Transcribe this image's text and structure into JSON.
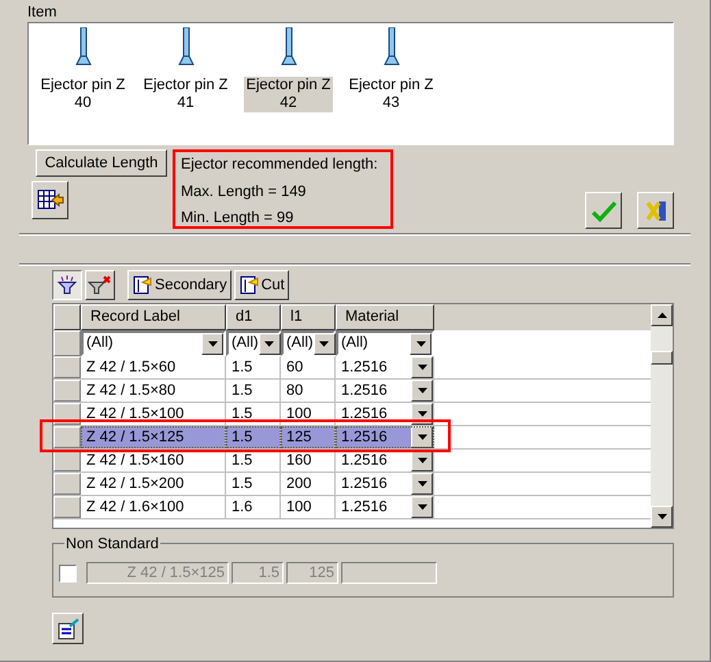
{
  "item_group": {
    "label": "Item"
  },
  "items": [
    {
      "name": "Ejector pin Z",
      "size": "40",
      "selected": false
    },
    {
      "name": "Ejector pin Z",
      "size": "41",
      "selected": false
    },
    {
      "name": "Ejector pin Z",
      "size": "42",
      "selected": true
    },
    {
      "name": "Ejector pin Z",
      "size": "43",
      "selected": false
    }
  ],
  "calculate_button": "Calculate Length",
  "recommendation": {
    "title": "Ejector recommended length:",
    "max": "Max. Length = 149",
    "min": "Min. Length = 99"
  },
  "toolbar": {
    "filter_on": true,
    "secondary": "Secondary",
    "cut": "Cut"
  },
  "table": {
    "columns": [
      "Record Label",
      "d1",
      "l1",
      "Material"
    ],
    "filters": [
      "(All)",
      "(All)",
      "(All)",
      "(All)"
    ],
    "rows": [
      {
        "label": "Z 42 / 1.5×60",
        "d1": "1.5",
        "l1": "60",
        "material": "1.2516",
        "selected": false
      },
      {
        "label": "Z 42 / 1.5×80",
        "d1": "1.5",
        "l1": "80",
        "material": "1.2516",
        "selected": false
      },
      {
        "label": "Z 42 / 1.5×100",
        "d1": "1.5",
        "l1": "100",
        "material": "1.2516",
        "selected": false
      },
      {
        "label": "Z 42 / 1.5×125",
        "d1": "1.5",
        "l1": "125",
        "material": "1.2516",
        "selected": true
      },
      {
        "label": "Z 42 / 1.5×160",
        "d1": "1.5",
        "l1": "160",
        "material": "1.2516",
        "selected": false
      },
      {
        "label": "Z 42 / 1.5×200",
        "d1": "1.5",
        "l1": "200",
        "material": "1.2516",
        "selected": false
      },
      {
        "label": "Z 42 / 1.6×100",
        "d1": "1.6",
        "l1": "100",
        "material": "1.2516",
        "selected": false
      }
    ]
  },
  "non_standard": {
    "label": "Non Standard",
    "checked": false,
    "label_value": "Z 42 / 1.5×125",
    "d1": "1.5",
    "l1": "125"
  }
}
